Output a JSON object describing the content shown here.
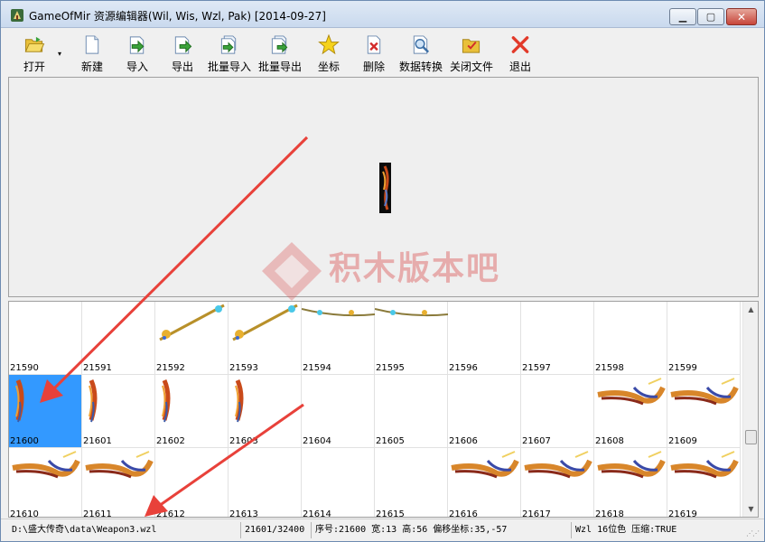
{
  "window": {
    "title": "GameOfMir 资源编辑器(Wil, Wis, Wzl, Pak) [2014-09-27]",
    "icon": "app-icon",
    "buttons": {
      "minimize": "minimize-icon",
      "maximize": "maximize-icon",
      "close": "close-icon"
    }
  },
  "toolbar": {
    "items": [
      {
        "label": "打开",
        "icon": "folder-open-icon"
      },
      {
        "label": "新建",
        "icon": "new-file-icon"
      },
      {
        "label": "导入",
        "icon": "import-icon"
      },
      {
        "label": "导出",
        "icon": "export-icon"
      },
      {
        "label": "批量导入",
        "icon": "batch-import-icon"
      },
      {
        "label": "批量导出",
        "icon": "batch-export-icon"
      },
      {
        "label": "坐标",
        "icon": "star-icon"
      },
      {
        "label": "删除",
        "icon": "delete-icon"
      },
      {
        "label": "数据转换",
        "icon": "convert-icon"
      },
      {
        "label": "关闭文件",
        "icon": "close-file-icon"
      },
      {
        "label": "退出",
        "icon": "exit-icon"
      }
    ],
    "dropdown_arrow": "▾"
  },
  "watermark": {
    "text": "积木版本吧"
  },
  "grid": {
    "rows": [
      [
        "21590",
        "21591",
        "21592",
        "21593",
        "21594",
        "21595",
        "21596",
        "21597",
        "21598",
        "21599"
      ],
      [
        "21600",
        "21601",
        "21602",
        "21603",
        "21604",
        "21605",
        "21606",
        "21607",
        "21608",
        "21609"
      ],
      [
        "21610",
        "21611",
        "21612",
        "21613",
        "21614",
        "21615",
        "21616",
        "21617",
        "21618",
        "21619"
      ]
    ],
    "selected": "21600"
  },
  "status": {
    "path": "D:\\盛大传奇\\data\\Weapon3.wzl",
    "position": "21601/32400",
    "info": "序号:21600 宽:13 高:56 偏移坐标:35,-57",
    "format": "Wzl 16位色 压缩:TRUE"
  },
  "colors": {
    "selection": "#3399ff",
    "arrow": "#e8413a",
    "watermark": "#dc5a5a"
  }
}
